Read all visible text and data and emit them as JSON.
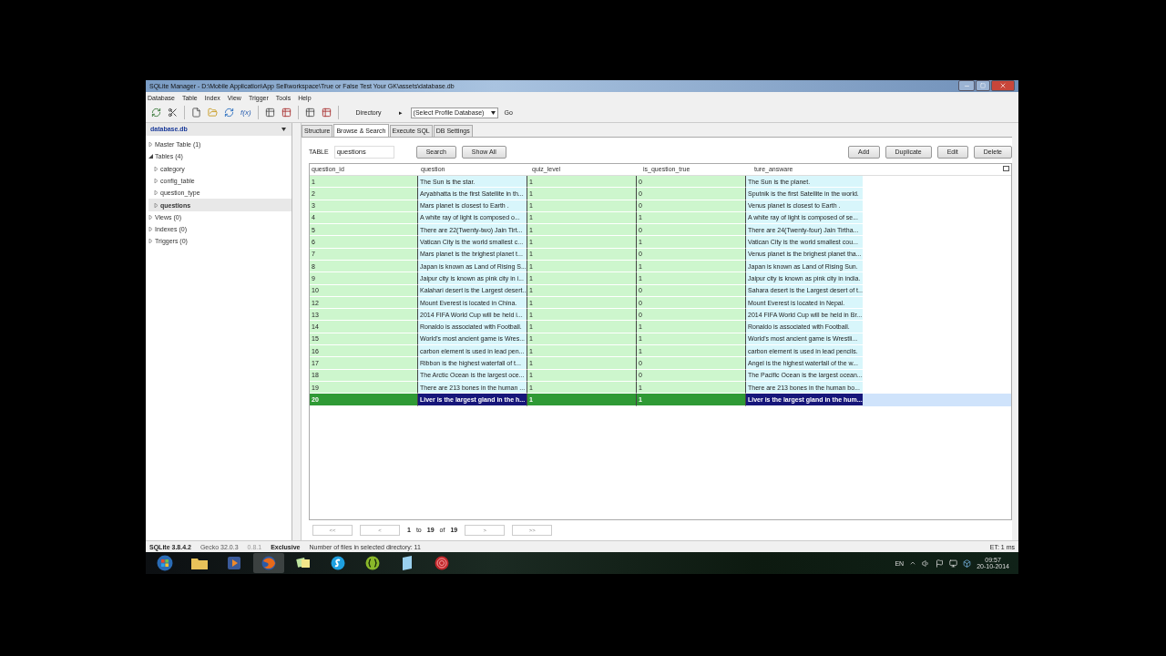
{
  "window": {
    "title": "SQLite Manager - D:\\Mobile Application\\App Sell\\workspace\\True or False Test Your GK\\assets\\database.db"
  },
  "menu": [
    "Database",
    "Table",
    "Index",
    "View",
    "Trigger",
    "Tools",
    "Help"
  ],
  "toolbar": {
    "function_label": "f(x)",
    "directory": "Directory",
    "arrow": "▸",
    "profile_select": "(Select Profile Database)",
    "go": "Go"
  },
  "sidebar": {
    "database": "database.db",
    "tree": [
      {
        "label": "Master Table (1)",
        "expanded": false,
        "selected": false
      },
      {
        "label": "Tables (4)",
        "expanded": true,
        "selected": false,
        "children": [
          {
            "label": "category",
            "expanded": false,
            "selected": false
          },
          {
            "label": "config_table",
            "expanded": false,
            "selected": false
          },
          {
            "label": "question_type",
            "expanded": false,
            "selected": false
          },
          {
            "label": "questions",
            "expanded": false,
            "selected": true
          }
        ]
      },
      {
        "label": "Views (0)",
        "expanded": false,
        "selected": false
      },
      {
        "label": "Indexes (0)",
        "expanded": false,
        "selected": false
      },
      {
        "label": "Triggers (0)",
        "expanded": false,
        "selected": false
      }
    ]
  },
  "tabs": [
    {
      "label": "Structure",
      "selected": false
    },
    {
      "label": "Browse & Search",
      "selected": true
    },
    {
      "label": "Execute SQL",
      "selected": false
    },
    {
      "label": "DB Settings",
      "selected": false
    }
  ],
  "browse": {
    "table_label": "TABLE",
    "table_value": "questions",
    "left_buttons": [
      "Search",
      "Show All"
    ],
    "right_buttons": [
      "Add",
      "Duplicate",
      "Edit",
      "Delete"
    ]
  },
  "table": {
    "columns": [
      "question_id",
      "question",
      "quiz_level",
      "is_question_true",
      "ture_answare"
    ],
    "rows": [
      {
        "selected": false,
        "cells": [
          "1",
          "The Sun is the star.",
          "1",
          "0",
          "The Sun is the planet."
        ]
      },
      {
        "selected": false,
        "cells": [
          "2",
          "Aryabhatta is the first Satellite in th...",
          "1",
          "0",
          "Sputnik is the first Satellite in the world."
        ]
      },
      {
        "selected": false,
        "cells": [
          "3",
          "Mars planet is closest to Earth .",
          "1",
          "0",
          "Venus planet is closest to Earth ."
        ]
      },
      {
        "selected": false,
        "cells": [
          "4",
          "A white ray of  light is composed o...",
          "1",
          "1",
          "A white ray of  light is composed of se..."
        ]
      },
      {
        "selected": false,
        "cells": [
          "5",
          "There are 22(Twenty-two) Jain Tirt...",
          "1",
          "0",
          "There are 24(Twenty-four) Jain Tirtha..."
        ]
      },
      {
        "selected": false,
        "cells": [
          "6",
          "Vatican City is the  world smallest c...",
          "1",
          "1",
          "Vatican City is the  world smallest cou..."
        ]
      },
      {
        "selected": false,
        "cells": [
          "7",
          "Mars planet is the brighest planet t...",
          "1",
          "0",
          "Venus planet is the brighest planet tha..."
        ]
      },
      {
        "selected": false,
        "cells": [
          "8",
          "Japan is known as Land of Rising S...",
          "1",
          "1",
          "Japan is known as Land of Rising Sun."
        ]
      },
      {
        "selected": false,
        "cells": [
          "9",
          "Jaipur city is known as pink city in i...",
          "1",
          "1",
          "Jaipur city is known as pink city in india."
        ]
      },
      {
        "selected": false,
        "cells": [
          "10",
          "Kalahari desert is the Largest desert...",
          "1",
          "0",
          "Sahara desert is the Largest desert of t..."
        ]
      },
      {
        "selected": false,
        "cells": [
          "12",
          "Mount Everest is located in China.",
          "1",
          "0",
          "Mount Everest is located in Nepal."
        ]
      },
      {
        "selected": false,
        "cells": [
          "13",
          "2014 FIFA World Cup will be held i...",
          "1",
          "0",
          "2014 FIFA World Cup will be held in Br..."
        ]
      },
      {
        "selected": false,
        "cells": [
          "14",
          "Ronaldo is associated with Football.",
          "1",
          "1",
          "Ronaldo is associated with Football."
        ]
      },
      {
        "selected": false,
        "cells": [
          "15",
          "World's most ancient game is Wres...",
          "1",
          "1",
          "World's most ancient game is Wrestli..."
        ]
      },
      {
        "selected": false,
        "cells": [
          "16",
          "carbon element is used in lead pen...",
          "1",
          "1",
          "carbon element is used in lead pencils."
        ]
      },
      {
        "selected": false,
        "cells": [
          "17",
          "Ribbon  is the highest waterfall of t...",
          "1",
          "0",
          "Angel is the highest waterfall of the w..."
        ]
      },
      {
        "selected": false,
        "cells": [
          "18",
          "The Arctic Ocean is the largest oce...",
          "1",
          "0",
          "The Pacific Ocean is the largest ocean..."
        ]
      },
      {
        "selected": false,
        "cells": [
          "19",
          "There are  213 bones in the human ...",
          "1",
          "1",
          "There are  213 bones in the human bo..."
        ]
      },
      {
        "selected": true,
        "cells": [
          "20",
          "Liver is the largest gland in the h...",
          "1",
          "1",
          "Liver is the largest gland in the hum..."
        ]
      }
    ]
  },
  "pager": {
    "first": "<<",
    "prev": "<",
    "from": "1",
    "to_word": "to",
    "to": "19",
    "of_word": "of",
    "total": "19",
    "next": ">",
    "last": ">>"
  },
  "status_bar": {
    "sqlite": "SQLite 3.8.4.2",
    "gecko": "Gecko 32.0.3",
    "version": "0.8.1",
    "mode": "Exclusive",
    "message": "Number of files in selected directory: 11",
    "elapsed": "ET: 1 ms"
  },
  "taskbar": {
    "language": "EN",
    "time": "09:57",
    "date": "20-10-2014"
  }
}
